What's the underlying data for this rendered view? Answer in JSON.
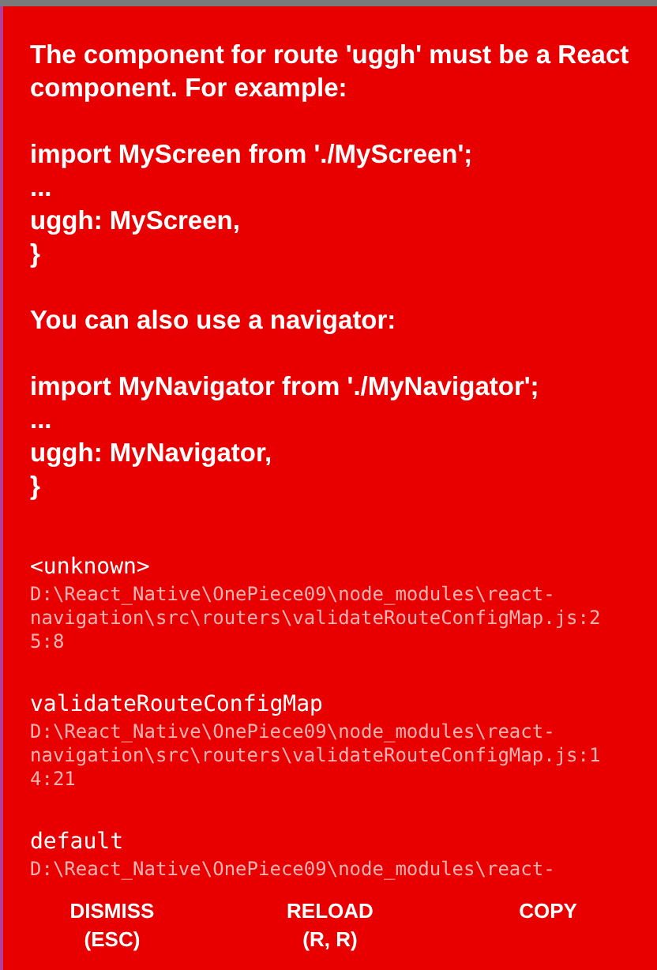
{
  "message": "The component for route 'uggh' must be a React component. For example:\n\nimport MyScreen from './MyScreen';\n...\nuggh: MyScreen,\n}\n\nYou can also use a navigator:\n\nimport MyNavigator from './MyNavigator';\n...\nuggh: MyNavigator,\n}",
  "stack": [
    {
      "method": "<unknown>",
      "location": "D:\\React_Native\\OnePiece09\\node_modules\\react-navigation\\src\\routers\\validateRouteConfigMap.js:25:8"
    },
    {
      "method": "validateRouteConfigMap",
      "location": "D:\\React_Native\\OnePiece09\\node_modules\\react-navigation\\src\\routers\\validateRouteConfigMap.js:14:21"
    },
    {
      "method": "default",
      "location": "D:\\React_Native\\OnePiece09\\node_modules\\react-"
    }
  ],
  "buttons": [
    {
      "label": "DISMISS",
      "shortcut": "(ESC)"
    },
    {
      "label": "RELOAD",
      "shortcut": "(R, R)"
    },
    {
      "label": "COPY"
    }
  ]
}
